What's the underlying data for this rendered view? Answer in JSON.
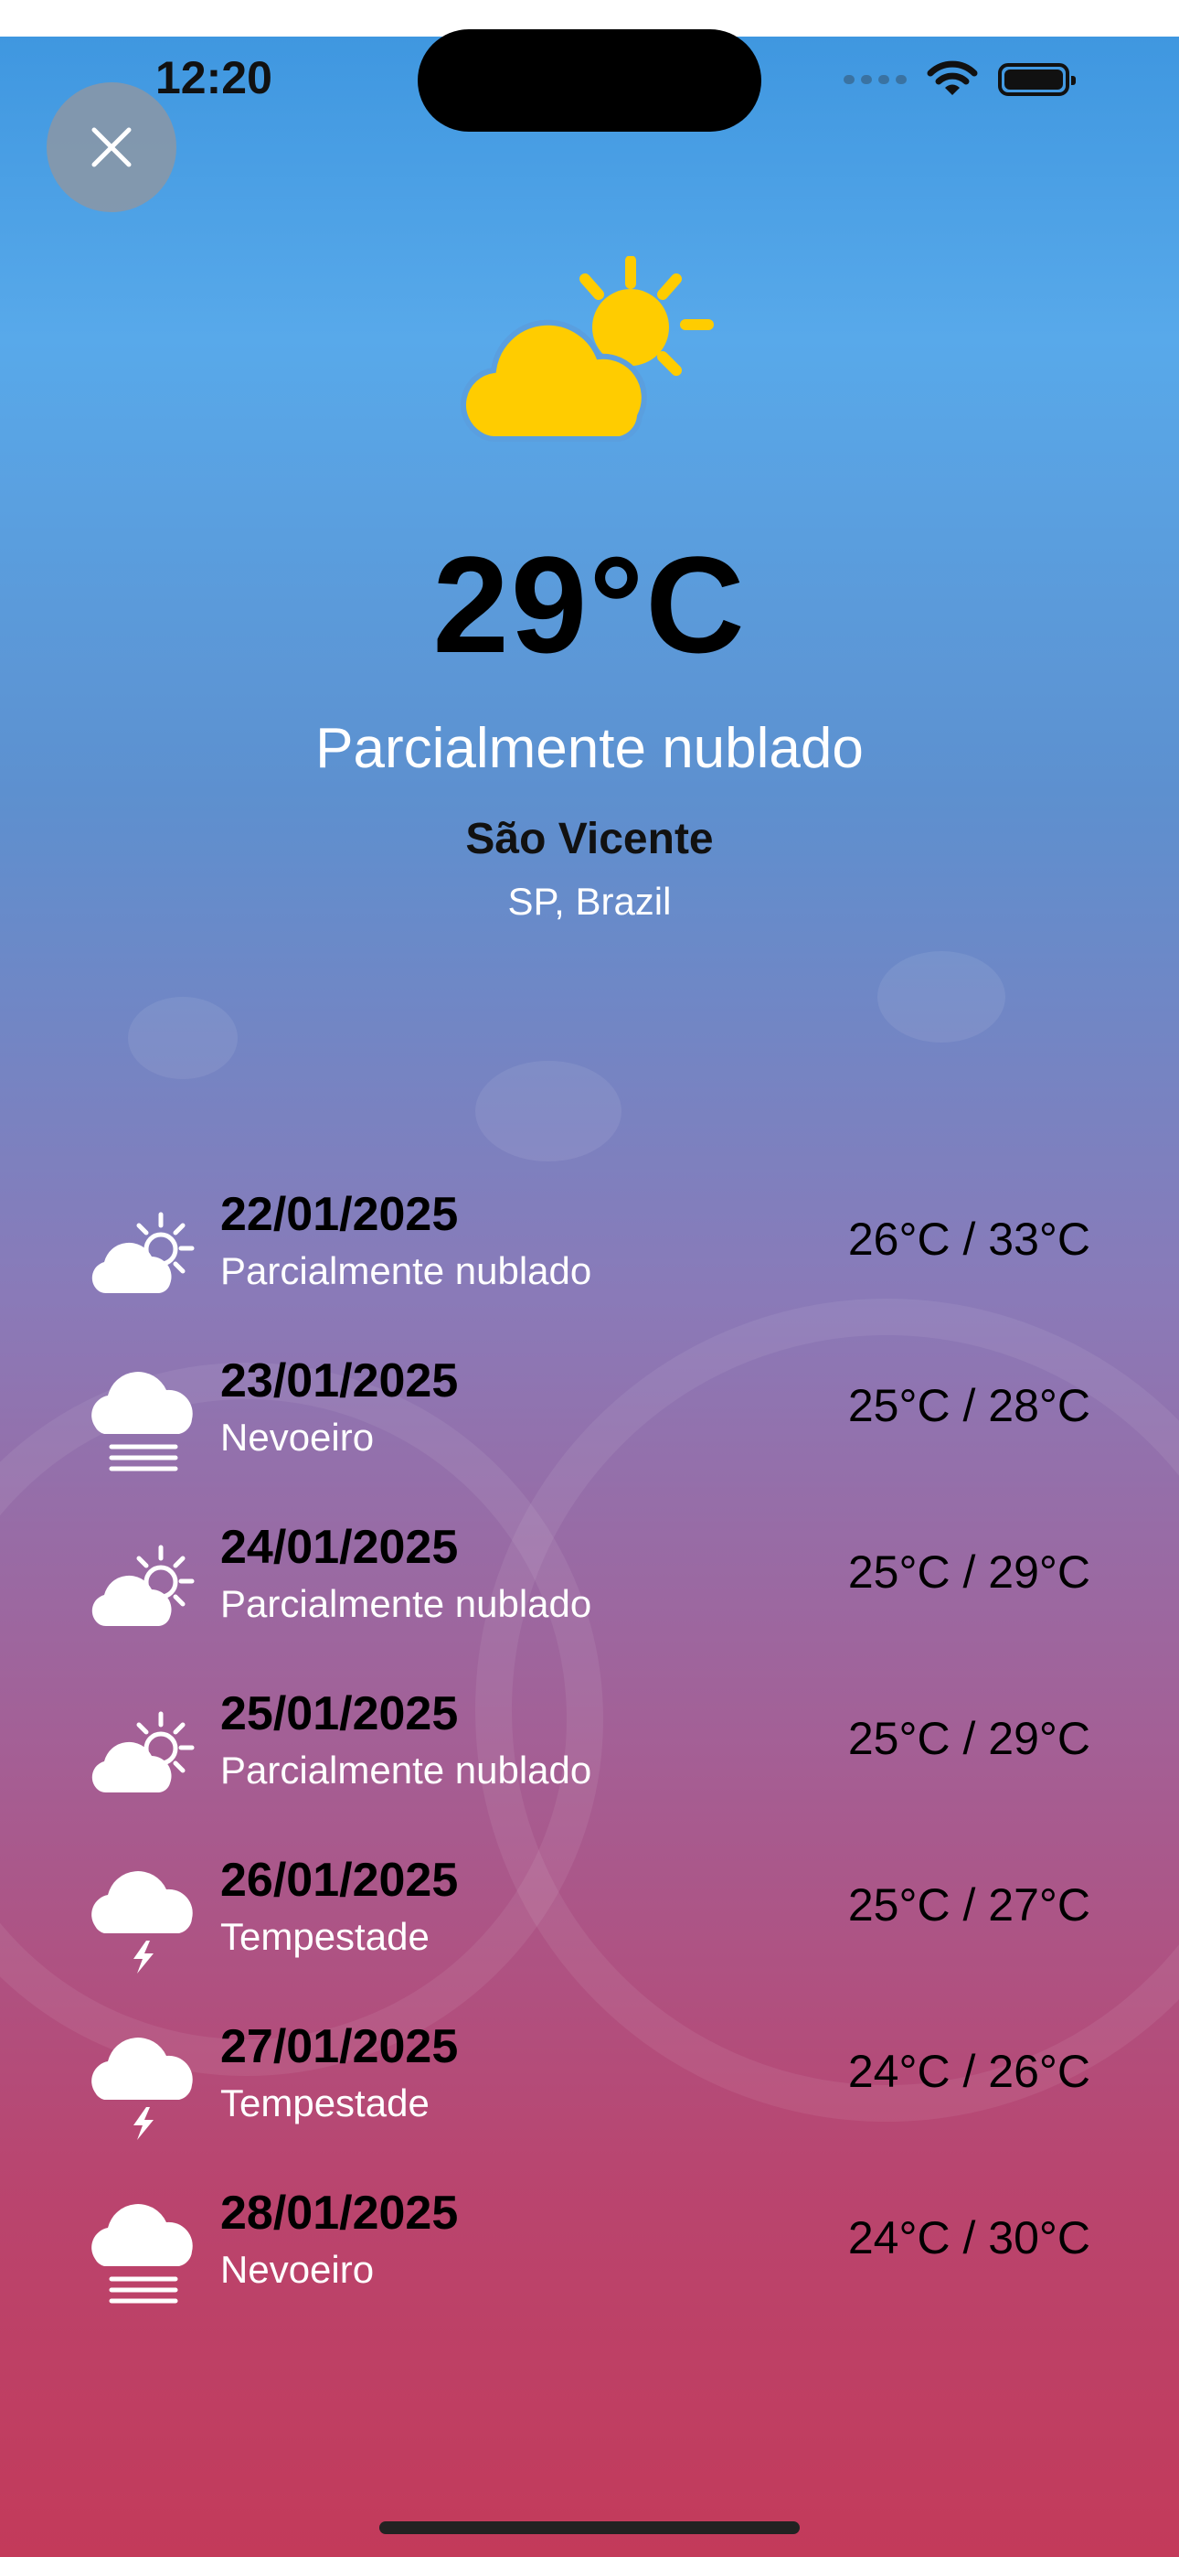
{
  "status_bar": {
    "time": "12:20"
  },
  "close_button": {
    "icon": "close-icon"
  },
  "current": {
    "icon": "partly-cloudy-icon",
    "temperature": "29°C",
    "condition": "Parcialmente nublado",
    "city": "São Vicente",
    "region": "SP, Brazil"
  },
  "forecast": [
    {
      "date": "22/01/2025",
      "condition": "Parcialmente nublado",
      "range": "26°C / 33°C",
      "icon": "partly-cloudy-icon"
    },
    {
      "date": "23/01/2025",
      "condition": "Nevoeiro",
      "range": "25°C / 28°C",
      "icon": "fog-icon"
    },
    {
      "date": "24/01/2025",
      "condition": "Parcialmente nublado",
      "range": "25°C / 29°C",
      "icon": "partly-cloudy-icon"
    },
    {
      "date": "25/01/2025",
      "condition": "Parcialmente nublado",
      "range": "25°C / 29°C",
      "icon": "partly-cloudy-icon"
    },
    {
      "date": "26/01/2025",
      "condition": "Tempestade",
      "range": "25°C / 27°C",
      "icon": "thunderstorm-icon"
    },
    {
      "date": "27/01/2025",
      "condition": "Tempestade",
      "range": "24°C / 26°C",
      "icon": "thunderstorm-icon"
    },
    {
      "date": "28/01/2025",
      "condition": "Nevoeiro",
      "range": "24°C / 30°C",
      "icon": "fog-icon"
    }
  ],
  "colors": {
    "sun_yellow": "#FFCC00",
    "gradient_top": "#3f97e0",
    "gradient_bottom": "#c33a5a"
  }
}
